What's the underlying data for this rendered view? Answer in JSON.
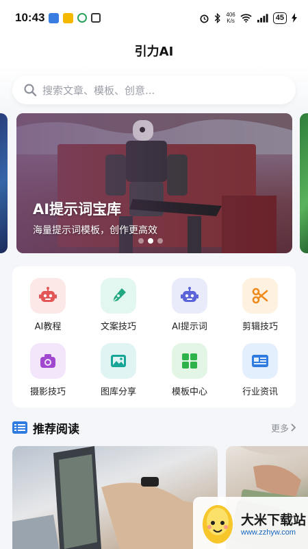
{
  "status_bar": {
    "time": "10:43",
    "net_speed_value": "406",
    "net_speed_unit": "K/s",
    "battery": "45"
  },
  "header": {
    "title": "引力AI"
  },
  "search": {
    "placeholder": "搜索文章、模板、创意..."
  },
  "banner": {
    "title": "AI提示词宝库",
    "subtitle": "海量提示词模板，创作更高效",
    "slide_count": 3,
    "active_slide": 2
  },
  "categories": [
    {
      "label": "AI教程",
      "icon": "robot-icon",
      "bg": "#fde8e8",
      "color": "#e25656"
    },
    {
      "label": "文案技巧",
      "icon": "pen-nib-icon",
      "bg": "#e3f7f1",
      "color": "#20a880"
    },
    {
      "label": "AI提示词",
      "icon": "robot-icon",
      "bg": "#e9ebfb",
      "color": "#5a63d8"
    },
    {
      "label": "剪辑技巧",
      "icon": "scissors-icon",
      "bg": "#fff1e0",
      "color": "#f08a1c"
    },
    {
      "label": "摄影技巧",
      "icon": "camera-icon",
      "bg": "#f3e6fa",
      "color": "#a048d0"
    },
    {
      "label": "图库分享",
      "icon": "image-icon",
      "bg": "#e0f5f3",
      "color": "#17a597"
    },
    {
      "label": "模板中心",
      "icon": "grid-icon",
      "bg": "#e3f6e6",
      "color": "#2eb24a"
    },
    {
      "label": "行业资讯",
      "icon": "newspaper-icon",
      "bg": "#e3effc",
      "color": "#2f7be0"
    }
  ],
  "recommended": {
    "title": "推荐阅读",
    "more_label": "更多"
  },
  "watermark": {
    "title": "大米下载站",
    "url": "www.zzhyw.com"
  },
  "colors": {
    "accent_blue": "#2f7be0",
    "page_bg": "#f4f6f9"
  }
}
